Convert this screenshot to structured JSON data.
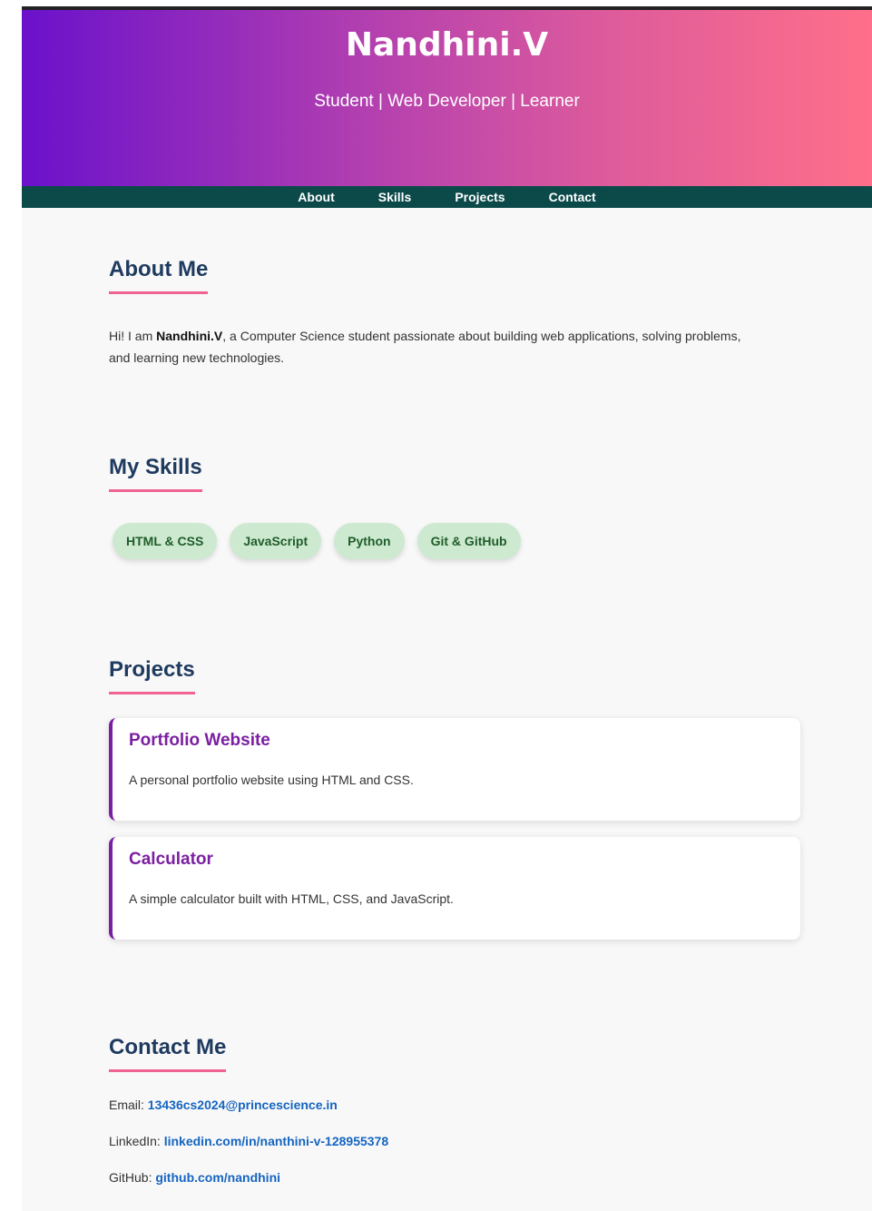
{
  "header": {
    "title": "Nandhini.V",
    "tagline": "Student | Web Developer | Learner"
  },
  "nav": {
    "items": [
      {
        "label": "About"
      },
      {
        "label": "Skills"
      },
      {
        "label": "Projects"
      },
      {
        "label": "Contact"
      }
    ]
  },
  "about": {
    "heading": "About Me",
    "intro": "Hi! I am ",
    "name": "Nandhini.V",
    "body": ", a Computer Science student passionate about building web applications, solving problems, and learning new technologies."
  },
  "skills": {
    "heading": "My Skills",
    "items": [
      "HTML & CSS",
      "JavaScript",
      "Python",
      "Git & GitHub"
    ]
  },
  "projects": {
    "heading": "Projects",
    "items": [
      {
        "title": "Portfolio Website",
        "description": "A personal portfolio website using HTML and CSS."
      },
      {
        "title": "Calculator",
        "description": "A simple calculator built with HTML, CSS, and JavaScript."
      }
    ]
  },
  "contact": {
    "heading": "Contact Me",
    "email_label": "Email: ",
    "email": "13436cs2024@princescience.in",
    "linkedin_label": "LinkedIn: ",
    "linkedin": "linkedin.com/in/nanthini-v-128955378",
    "github_label": "GitHub: ",
    "github": "github.com/nandhini"
  },
  "colors": {
    "gradient_start": "#6a11cb",
    "gradient_end": "#ff6f8a",
    "nav_bg": "#0c4a4a",
    "heading": "#1e3a5f",
    "underline": "#f06292",
    "project_accent": "#7b1fa2",
    "skill_bg": "#cde9d0",
    "link": "#1565c0"
  }
}
